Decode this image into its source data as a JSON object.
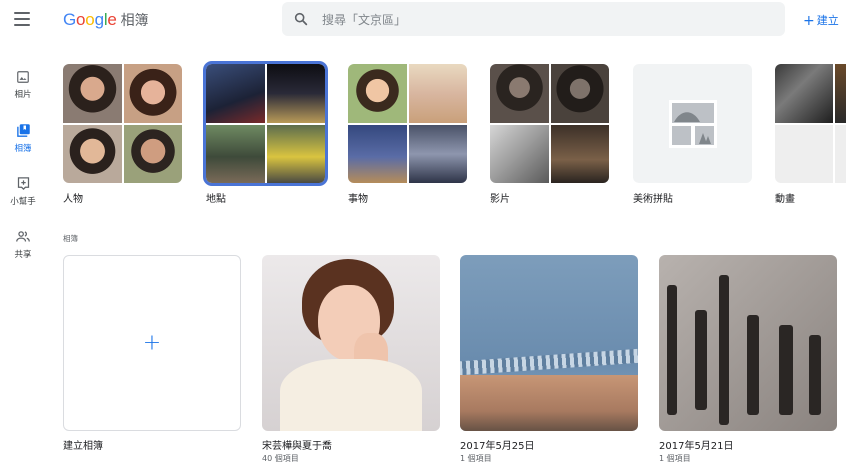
{
  "header": {
    "logo_letters": [
      "G",
      "o",
      "o",
      "g",
      "l",
      "e"
    ],
    "product": "相簿",
    "search_placeholder": "搜尋「文京區」",
    "create_label": "建立",
    "create_plus": "+"
  },
  "sidebar": {
    "items": [
      {
        "label": "相片",
        "icon": "photo-icon",
        "active": false
      },
      {
        "label": "相簿",
        "icon": "album-icon",
        "active": true
      },
      {
        "label": "小幫手",
        "icon": "assistant-icon",
        "active": false
      },
      {
        "label": "共享",
        "icon": "people-icon",
        "active": false
      }
    ]
  },
  "categories": [
    {
      "label": "人物"
    },
    {
      "label": "地點",
      "selected": true
    },
    {
      "label": "事物"
    },
    {
      "label": "影片"
    },
    {
      "label": "美術拼貼"
    },
    {
      "label": "動畫"
    }
  ],
  "section_title": "相簿",
  "albums": [
    {
      "title": "建立相簿",
      "count": "",
      "plus": "+"
    },
    {
      "title": "宋芸樺與夏于喬",
      "count": "40 個項目"
    },
    {
      "title": "2017年5月25日",
      "count": "1 個項目"
    },
    {
      "title": "2017年5月21日",
      "count": "1 個項目"
    }
  ],
  "colors": {
    "accent": "#1a73e8",
    "selected_outline": "#4a74d6",
    "search_bg": "#f1f3f4"
  }
}
